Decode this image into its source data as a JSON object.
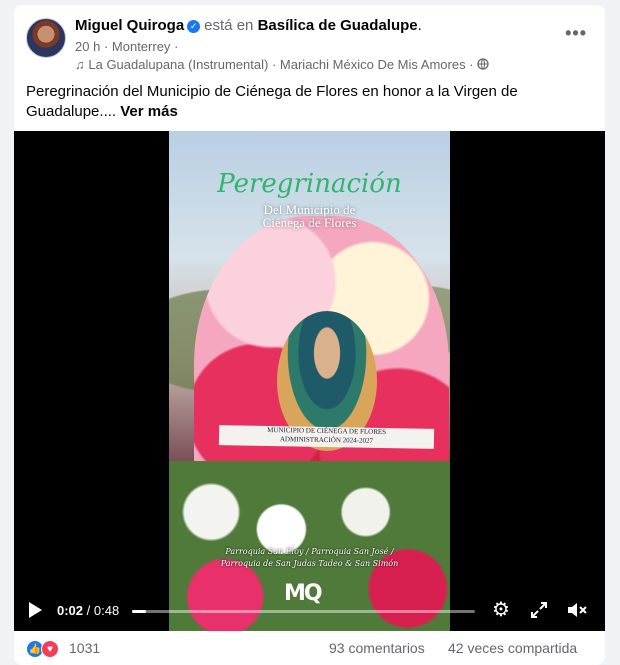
{
  "post": {
    "author": "Miguel Quiroga",
    "verb": "está en",
    "place": "Basílica de Guadalupe",
    "place_suffix": ".",
    "time": "20 h",
    "dot": "·",
    "location": "Monterrey",
    "music_icon": "music-note-icon",
    "song": "La Guadalupana (Instrumental)",
    "artist": "Mariachi México De Mis Amores",
    "privacy_icon": "globe-icon",
    "more_label": "•••",
    "text": "Peregrinación del Municipio de Ciénega de Flores en honor a la Virgen de Guadalupe....",
    "see_more": "Ver más"
  },
  "video": {
    "overlay_title": "Peregrinación",
    "overlay_sub1": "Del Municipio de",
    "overlay_sub2": "Ciénega de Flores",
    "banner_line1": "MUNICIPIO DE CIÉNEGA DE FLORES",
    "banner_line2": "ADMINISTRACIÓN 2024-2027",
    "parishes_line1": "Parroquia San Eloy / Parroquia San José /",
    "parishes_line2": "Parroquia de San Judas Tadeo & San Simón",
    "logo": "MQ",
    "current_time": "0:02",
    "separator": " / ",
    "total_time": "0:48",
    "progress": 0.04
  },
  "footer": {
    "reaction_count": "1031",
    "comments": "93 comentarios",
    "shares": "42 veces compartida"
  }
}
